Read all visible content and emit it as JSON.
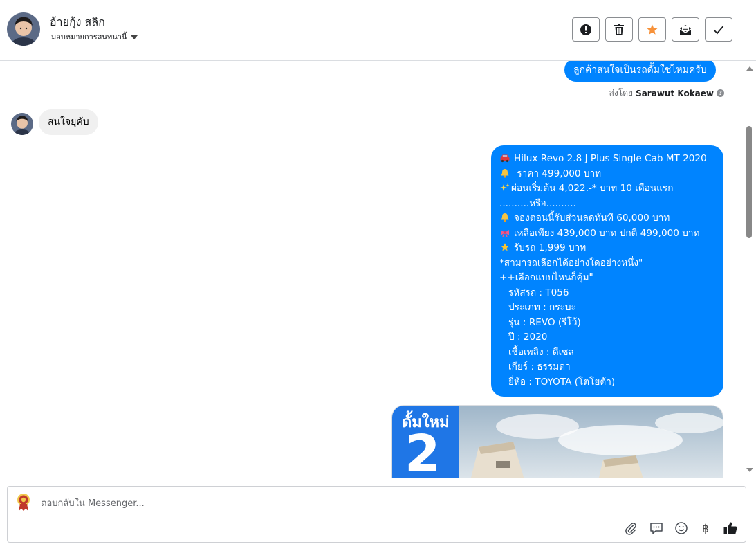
{
  "header": {
    "contact_name": "อ้ายกุ้ง สลิก",
    "assign_label": "มอบหมายการสนทนานี้",
    "accent": "#f7923a"
  },
  "thread": {
    "prev_outgoing": "ลูกค้าสนใจเป็นรถดั้มใช่ไหมครับ",
    "sent_by_prefix": "ส่งโดย",
    "sent_by_name": "Sarawut Kokaew",
    "incoming": "สนใจยุคับ",
    "listing": {
      "lines": [
        {
          "icon": "car-icon",
          "text": "Hilux Revo 2.8 J Plus Single Cab MT 2020"
        },
        {
          "icon": "bell-icon",
          "text": " ราคา 499,000 บาท"
        },
        {
          "icon": "sparkles-icon",
          "text": "ผ่อนเริ่มต้น 4,022.-* บาท 10 เดือนแรก"
        },
        {
          "icon": "",
          "text": "..........หรือ.........."
        },
        {
          "icon": "bell-icon",
          "text": "จองตอนนี้รับส่วนลดทันที 60,000 บาท"
        },
        {
          "icon": "ribbon-icon",
          "text": "เหลือเพียง 439,000 บาท ปกติ 499,000 บาท"
        },
        {
          "icon": "star-icon",
          "text": "รับรถ 1,999 บาท"
        },
        {
          "icon": "",
          "text": "*สามารถเลือกได้อย่างใดอย่างหนึ่ง\""
        },
        {
          "icon": "",
          "text": "++เลือกแบบไหนก็คุ้ม\""
        },
        {
          "icon": "",
          "text": "   รหัสรถ : T056"
        },
        {
          "icon": "",
          "text": "   ประเภท : กระบะ"
        },
        {
          "icon": "",
          "text": "   รุ่น : REVO (รีโว้)"
        },
        {
          "icon": "",
          "text": "   ปี : 2020"
        },
        {
          "icon": "",
          "text": "   เชื้อเพลิง : ดีเซล"
        },
        {
          "icon": "",
          "text": "   เกียร์ : ธรรมดา"
        },
        {
          "icon": "",
          "text": "   ยี่ห้อ : TOYOTA (โตโยต้า)"
        }
      ]
    },
    "image_banner": {
      "line1": "ดั้มใหม่",
      "line2": "2"
    }
  },
  "composer": {
    "placeholder": "ตอบกลับใน Messenger..."
  },
  "colors": {
    "outgoing_bubble": "#0084ff",
    "incoming_bubble": "#f0f0f0",
    "banner_blue": "#1f76e6"
  }
}
